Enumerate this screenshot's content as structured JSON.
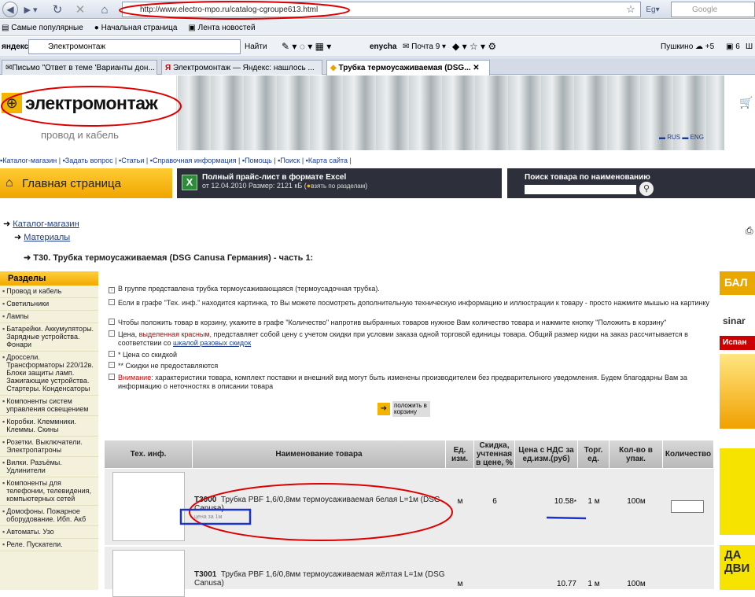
{
  "browser": {
    "url": "http://www.electro-mpo.ru/catalog-cgroupe613.html",
    "search_placeholder": "Google",
    "bookmarks": [
      "Самые популярные",
      "Начальная страница",
      "Лента новостей"
    ],
    "toolbar": {
      "site_label": "яндекс",
      "ya_query": "Электромонтаж",
      "find_label": "Найти",
      "enycha": "enycha",
      "mail_label": "Почта 9",
      "weather": "Пушкино",
      "temp": "+5",
      "count": "6",
      "shop_label": "Ш"
    },
    "tabs": [
      "Письмо \"Ответ в теме 'Варианты дон...",
      "Электромонтаж — Яндекс: нашлось ...",
      "Трубка термоусаживаемая (DSG..."
    ]
  },
  "site": {
    "logo": "электромонтаж",
    "tagline": "провод и кабель",
    "lang_ru": "RUS",
    "lang_en": "ENG",
    "nav": [
      "Каталог-магазин",
      "Задать вопрос",
      "Статьи",
      "Справочная информация",
      "Помощь",
      "Поиск",
      "Карта сайта"
    ],
    "home": "Главная страница",
    "price_title": "Полный прайс-лист в формате Excel",
    "price_meta": "от 12.04.2010 Размер: 2121 кБ",
    "price_split": "взять по разделам",
    "search_title": "Поиск товара по наименованию",
    "breadcrumb_1": "Каталог-магазин",
    "breadcrumb_2": "Материалы",
    "page_title": "T30. Трубка термоусаживаемая (DSG Canusa Германия) - часть 1:"
  },
  "sidebar": {
    "title": "Разделы",
    "items": [
      "Провод и кабель",
      "Светильники",
      "Лампы",
      "Батарейки. Аккумуляторы. Зарядные устройства. Фонари",
      "Дроссели. Трансформаторы 220/12в. Блоки защиты ламп. Зажигающие устройства. Стартеры. Конденсаторы",
      "Компоненты систем управления освещением",
      "Коробки. Клеммники. Клеммы. Скины",
      "Розетки. Выключатели. Электропатроны",
      "Вилки. Разъёмы. Удлинители",
      "Компоненты для телефонии, телевидения, компьютерных сетей",
      "Домофоны. Пожарное оборудование. Ибп. Акб",
      "Автоматы. Узо",
      "Реле. Пускатели."
    ]
  },
  "info": {
    "l1": "В группе представлена трубка термоусаживающаяся (термоусадочная трубка).",
    "l2": "Если в графе \"Тех. инф.\" находится картинка, то Вы можете посмотреть дополнительную техническую информацию и иллюстрации к товару - просто нажмите мышью на картинку",
    "l3": "Чтобы положить товар в корзину, укажите в графе \"Количество\" напротив выбранных товаров нужное Вам количество товара и нажмите кнопку \"Положить в корзину\"",
    "l4a": "Цена,",
    "l4b": "выделенная красным,",
    "l4c": "представляет собой цену с учетом скидки при условии заказа одной торговой единицы товара. Общий размер кидки на заказ рассчитывается в соответствии со",
    "l4d": "шкалой разовых скидок",
    "l5": "* Цена со скидкой",
    "l6": "** Скидки не предоставляются",
    "l7a": "Внимание:",
    "l7b": "характеристики товара, комплект поставки и внешний вид могут быть изменены производителем без предварительного уведомления. Будем благодарны Вам за информацию о неточностях в описании товара"
  },
  "add_to_cart": "положить в корзину",
  "table": {
    "headers": [
      "Тех. инф.",
      "Наименование товара",
      "Ед. изм.",
      "Скидка, учтенная в цене, %",
      "Цена с НДС за ед.изм.(руб)",
      "Торг. ед.",
      "Кол-во в упак.",
      "Количество"
    ],
    "rows": [
      {
        "code": "T3000",
        "name": "Трубка PBF 1,6/0,8мм термоусаживаемая белая L=1м (DSG Canusa)",
        "sub": "цена за 1м",
        "unit": "м",
        "discount": "6",
        "price": "10.58",
        "mark": "*",
        "trade": "1 м",
        "pack": "100м"
      },
      {
        "code": "T3001",
        "name": "Трубка PBF 1,6/0,8мм термоусаживаемая жёлтая L=1м (DSG Canusa)",
        "sub": "",
        "unit": "м",
        "discount": "",
        "price": "10.77",
        "mark": "",
        "trade": "1 м",
        "pack": "100м"
      }
    ]
  },
  "ads": [
    "БАЛ",
    "sinar",
    "Испан",
    "ДА",
    "ДВИ"
  ]
}
